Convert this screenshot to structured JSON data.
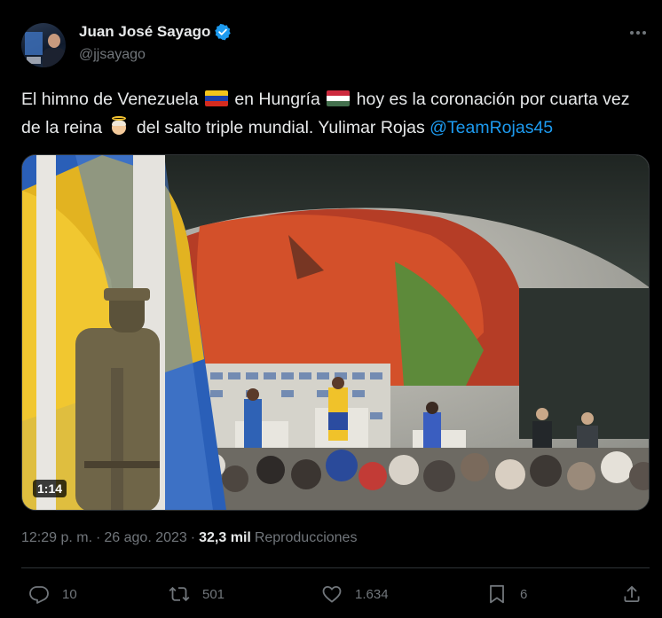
{
  "author": {
    "display_name": "Juan José Sayago",
    "handle": "@jjsayago",
    "verified": true,
    "verified_color": "#1d9bf0"
  },
  "tweet": {
    "text_part1": "El himno de Venezuela ",
    "text_part2": " en Hungría ",
    "text_part3": " hoy es la coronación por cuarta vez de la reina ",
    "text_part4": " del salto triple mundial. Yulimar Rojas ",
    "mention": "@TeamRojas45",
    "emojis": [
      "venezuela-flag",
      "hungary-flag",
      "angel"
    ]
  },
  "media": {
    "type": "video",
    "duration": "1:14"
  },
  "meta": {
    "time": "12:29 p. m.",
    "date": "26 ago. 2023",
    "separator": "·",
    "views_count": "32,3 mil",
    "views_label": "Reproducciones"
  },
  "actions": {
    "replies": "10",
    "reposts": "501",
    "likes": "1.634",
    "bookmarks": "6"
  },
  "colors": {
    "background": "#000000",
    "text": "#e7e9ea",
    "secondary": "#71767b",
    "accent": "#1d9bf0",
    "divider": "#2f3336"
  }
}
